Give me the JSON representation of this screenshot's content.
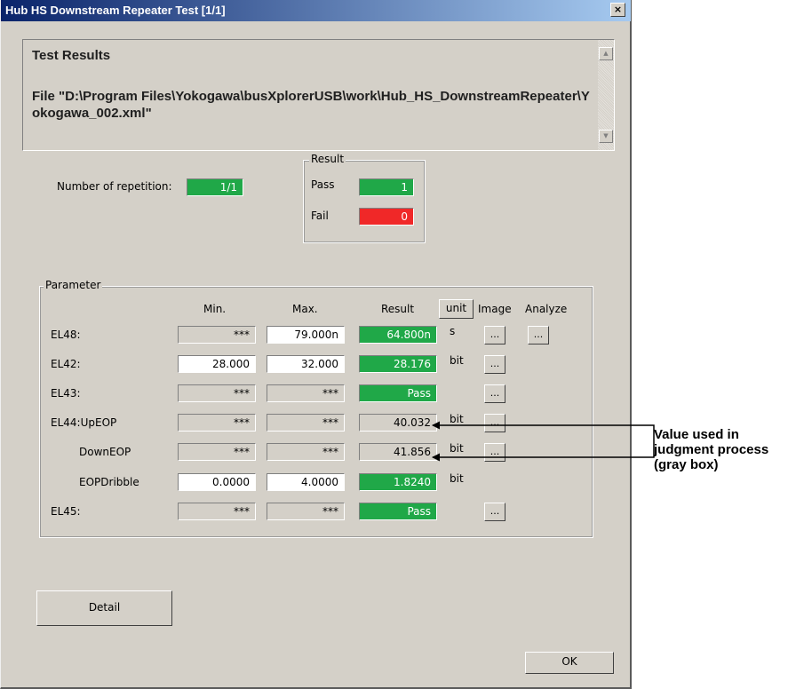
{
  "window": {
    "title": "Hub HS Downstream Repeater Test [1/1]",
    "close_glyph": "×"
  },
  "results": {
    "heading": "Test Results",
    "file_path": "File \"D:\\Program Files\\Yokogawa\\busXplorerUSB\\work\\Hub_HS_DownstreamRepeater\\Yokogawa_002.xml\""
  },
  "repetition": {
    "label": "Number of repetition:",
    "value": "1/1"
  },
  "result_group": {
    "title": "Result",
    "pass_label": "Pass",
    "pass_value": "1",
    "fail_label": "Fail",
    "fail_value": "0"
  },
  "parameter": {
    "title": "Parameter",
    "headers": {
      "min": "Min.",
      "max": "Max.",
      "result": "Result",
      "unit": "unit",
      "image": "Image",
      "analyze": "Analyze"
    },
    "rows": [
      {
        "name": "EL48:",
        "min": "***",
        "max": "79.000n",
        "result": "64.800n",
        "unit": "s"
      },
      {
        "name": "EL42:",
        "min": "28.000",
        "max": "32.000",
        "result": "28.176",
        "unit": "bit"
      },
      {
        "name": "EL43:",
        "min": "***",
        "max": "***",
        "result": "Pass",
        "unit": ""
      },
      {
        "name": "EL44:UpEOP",
        "min": "***",
        "max": "***",
        "result": "40.032",
        "unit": "bit"
      },
      {
        "name": "DownEOP",
        "min": "***",
        "max": "***",
        "result": "41.856",
        "unit": "bit"
      },
      {
        "name": "EOPDribble",
        "min": "0.0000",
        "max": "4.0000",
        "result": "1.8240",
        "unit": "bit"
      },
      {
        "name": "EL45:",
        "min": "***",
        "max": "***",
        "result": "Pass",
        "unit": ""
      }
    ],
    "ellipsis": "..."
  },
  "buttons": {
    "detail": "Detail",
    "ok": "OK"
  },
  "annotation": {
    "text": "Value used in judgment process (gray box)"
  },
  "colors": {
    "pass_green": "#20a848",
    "fail_red": "#f02828",
    "titlebar_start": "#0a246a",
    "titlebar_end": "#a6caf0"
  }
}
